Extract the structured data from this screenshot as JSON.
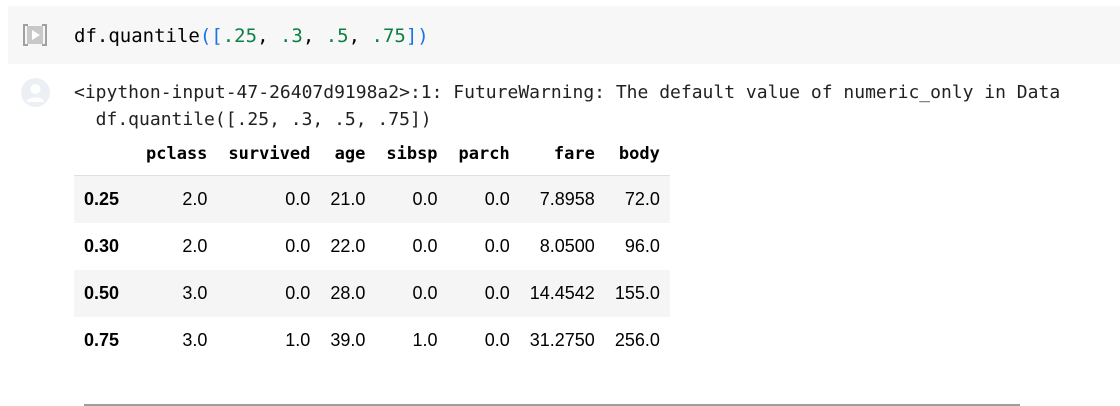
{
  "code_cell": {
    "prefix": "df.quantile(",
    "open_brackets": "([",
    "values": [
      ".25",
      ".3",
      ".5",
      ".75"
    ],
    "separator": ", ",
    "close_brackets": "])"
  },
  "output": {
    "warning_line1": "<ipython-input-47-26407d9198a2>:1: FutureWarning: The default value of numeric_only in Data",
    "warning_line2": "  df.quantile([.25, .3, .5, .75])",
    "table": {
      "columns": [
        "pclass",
        "survived",
        "age",
        "sibsp",
        "parch",
        "fare",
        "body"
      ],
      "rows": [
        {
          "index": "0.25",
          "cells": [
            "2.0",
            "0.0",
            "21.0",
            "0.0",
            "0.0",
            "7.8958",
            "72.0"
          ]
        },
        {
          "index": "0.30",
          "cells": [
            "2.0",
            "0.0",
            "22.0",
            "0.0",
            "0.0",
            "8.0500",
            "96.0"
          ]
        },
        {
          "index": "0.50",
          "cells": [
            "3.0",
            "0.0",
            "28.0",
            "0.0",
            "0.0",
            "14.4542",
            "155.0"
          ]
        },
        {
          "index": "0.75",
          "cells": [
            "3.0",
            "1.0",
            "39.0",
            "1.0",
            "0.0",
            "31.2750",
            "256.0"
          ]
        }
      ]
    }
  },
  "icons": {
    "run": "run-cell-icon",
    "output": "output-avatar-icon"
  },
  "colors": {
    "cell_background": "#f7f7f7",
    "bracket_blue": "#1a73e8",
    "number_green": "#0b8043",
    "table_stripe": "#f5f5f5"
  }
}
